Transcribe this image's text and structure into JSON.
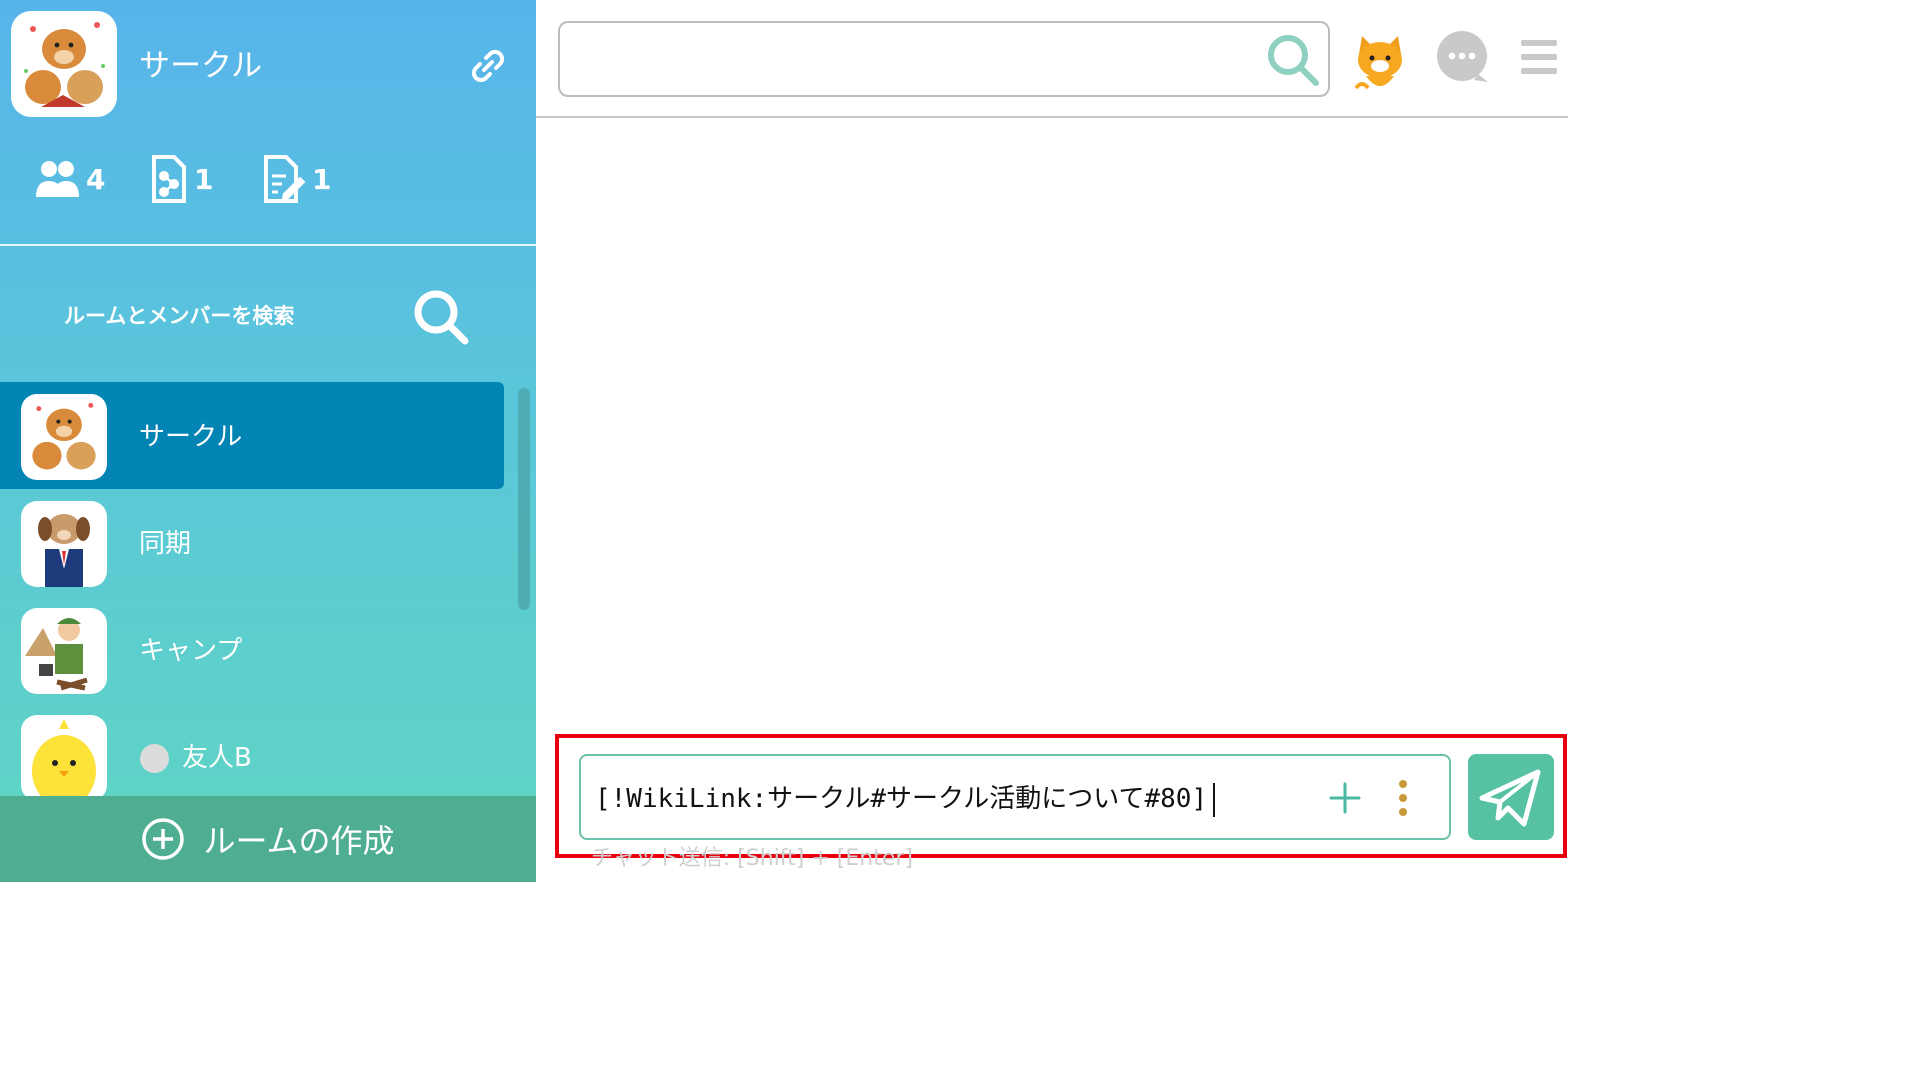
{
  "sidebar": {
    "room_title": "サークル",
    "stats": {
      "members": "4",
      "files": "1",
      "notes": "1"
    },
    "search_label": "ルームとメンバーを検索",
    "rooms": [
      {
        "name": "サークル",
        "active": true
      },
      {
        "name": "同期",
        "active": false
      },
      {
        "name": "キャンプ",
        "active": false
      },
      {
        "name": "友人B",
        "active": false,
        "status": "offline"
      }
    ],
    "create_room_label": "ルームの作成"
  },
  "header": {
    "search_value": "",
    "icons": [
      "search-icon",
      "cat-avatar-icon",
      "chat-bubble-icon",
      "menu-icon"
    ]
  },
  "composer": {
    "text": "[!WikiLink:サークル#サークル活動について#80]",
    "hint": "チャット送信: [Shift] + [Enter]"
  },
  "colors": {
    "sidebar_top": "#57b4ea",
    "sidebar_bottom": "#5fd6c2",
    "active_room": "#0284b4",
    "create_room_bg": "#4fae91",
    "send_button": "#56c2a3",
    "highlight_border": "#e8000f"
  }
}
